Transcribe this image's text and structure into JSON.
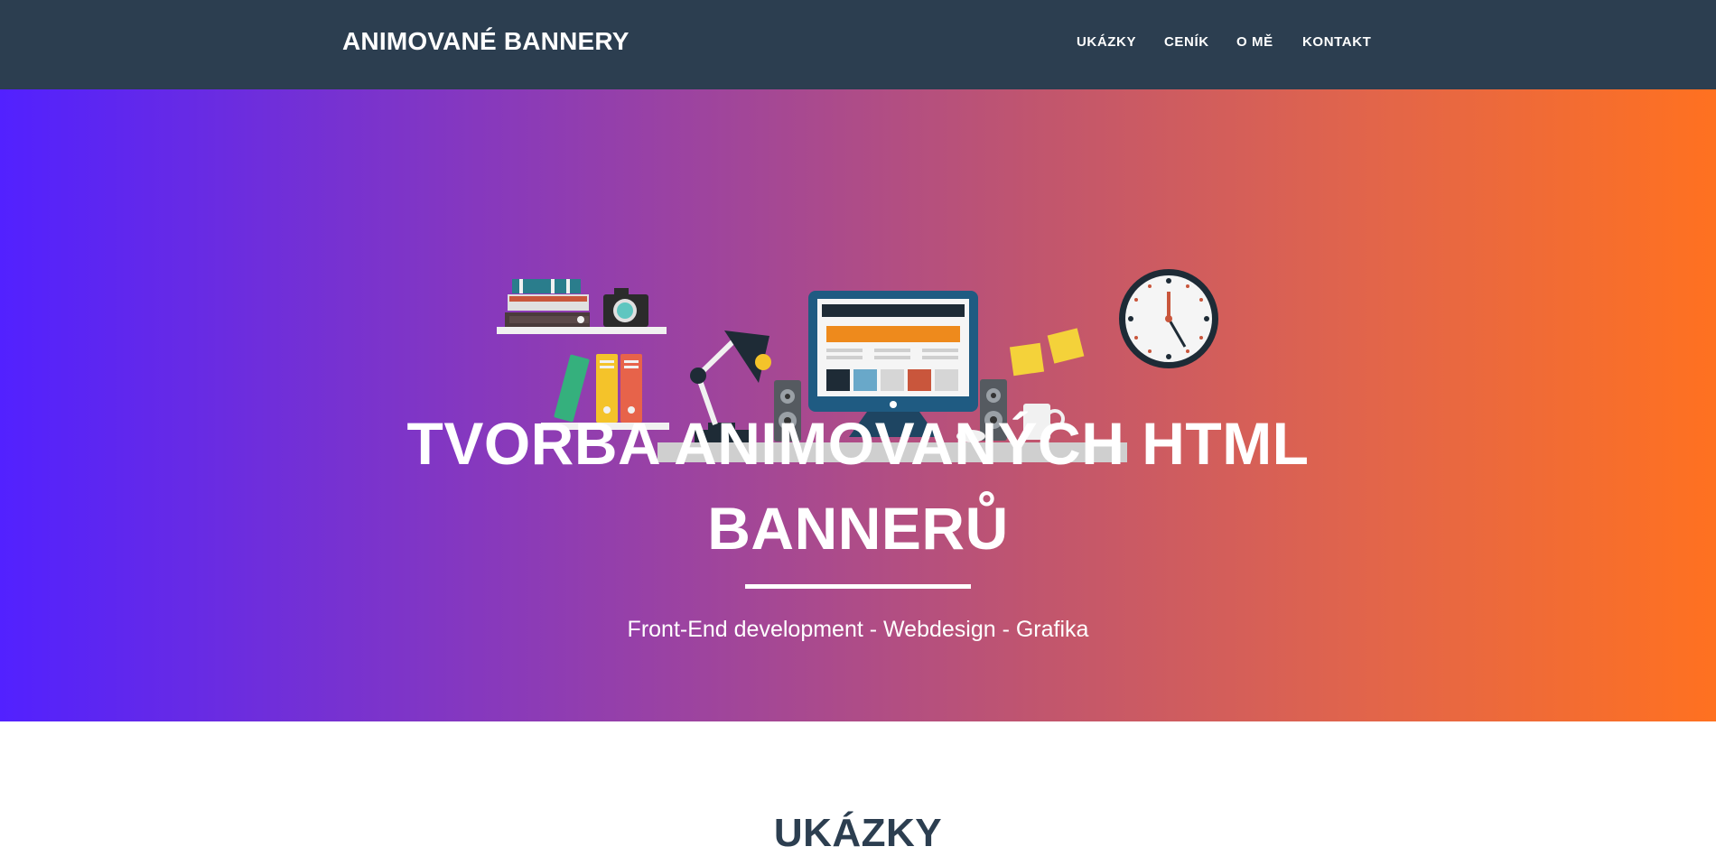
{
  "nav": {
    "brand": "ANIMOVANÉ BANNERY",
    "links": [
      "UKÁZKY",
      "CENÍK",
      "O MĚ",
      "KONTAKT"
    ]
  },
  "hero": {
    "title_line1": "TVORBA ANIMOVANÝCH HTML",
    "title_line2": "BANNERŮ",
    "subtitle": "Front-End development - Webdesign - Grafika"
  },
  "sections": {
    "gallery_heading": "UKÁZKY"
  },
  "colors": {
    "navbar": "#2c3e50",
    "hero_gradient_start": "#5221ff",
    "hero_gradient_end": "#ff7120",
    "text_light": "#ffffff",
    "heading_dark": "#2c3e50"
  },
  "icons": [
    "workspace-illustration",
    "bookshelf-icon",
    "camera-icon",
    "desk-lamp-icon",
    "monitor-icon",
    "speaker-icon",
    "coffee-mug-icon",
    "sticky-notes-icon",
    "wall-clock-icon"
  ]
}
